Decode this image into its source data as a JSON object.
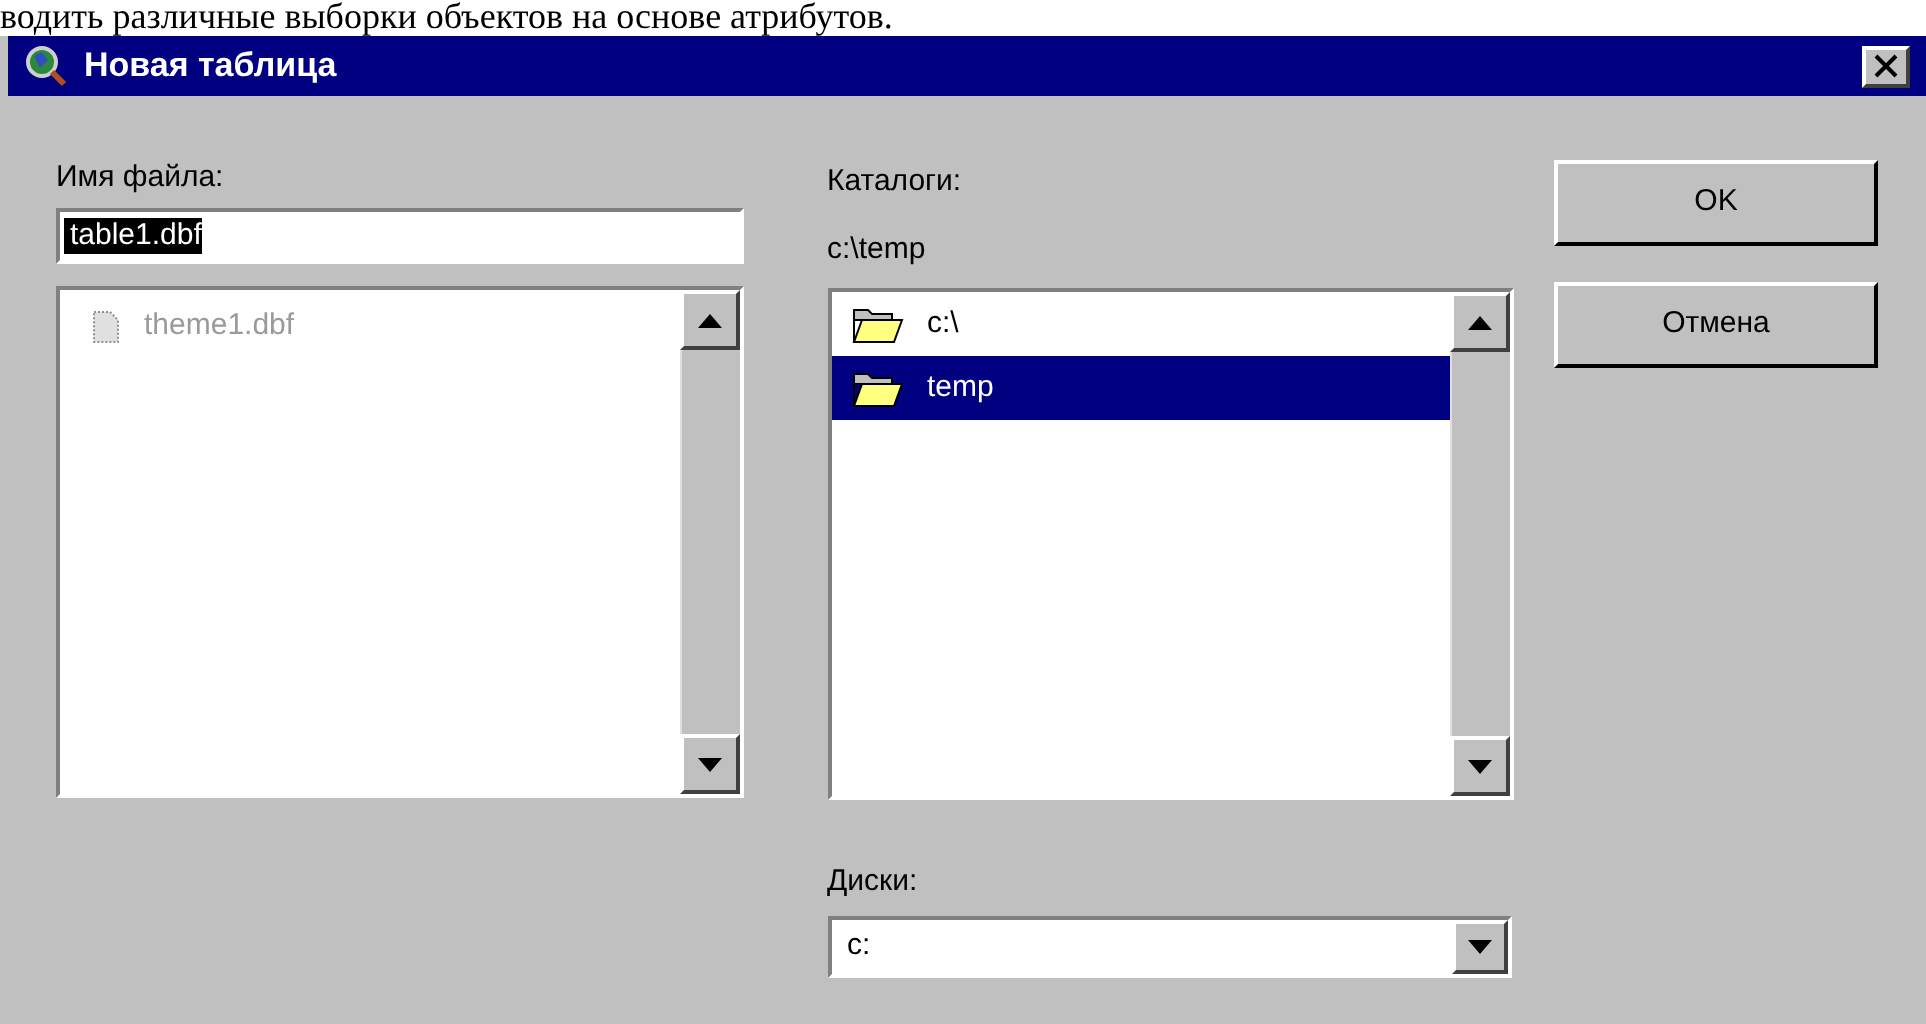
{
  "document_text": "водить различные выборки объектов на основе атрибутов.",
  "window": {
    "title": "Новая таблица"
  },
  "file_name": {
    "label": "Имя файла:",
    "value": "table1.dbf"
  },
  "files": [
    {
      "name": "theme1.dbf",
      "disabled": true
    }
  ],
  "directories": {
    "label": "Каталоги:",
    "path": "c:\\temp",
    "items": [
      {
        "name": "c:\\",
        "selected": false
      },
      {
        "name": "temp",
        "selected": true
      }
    ]
  },
  "buttons": [
    "OK",
    "Отмена"
  ],
  "drives": {
    "label": "Диски:",
    "value": "c:"
  }
}
